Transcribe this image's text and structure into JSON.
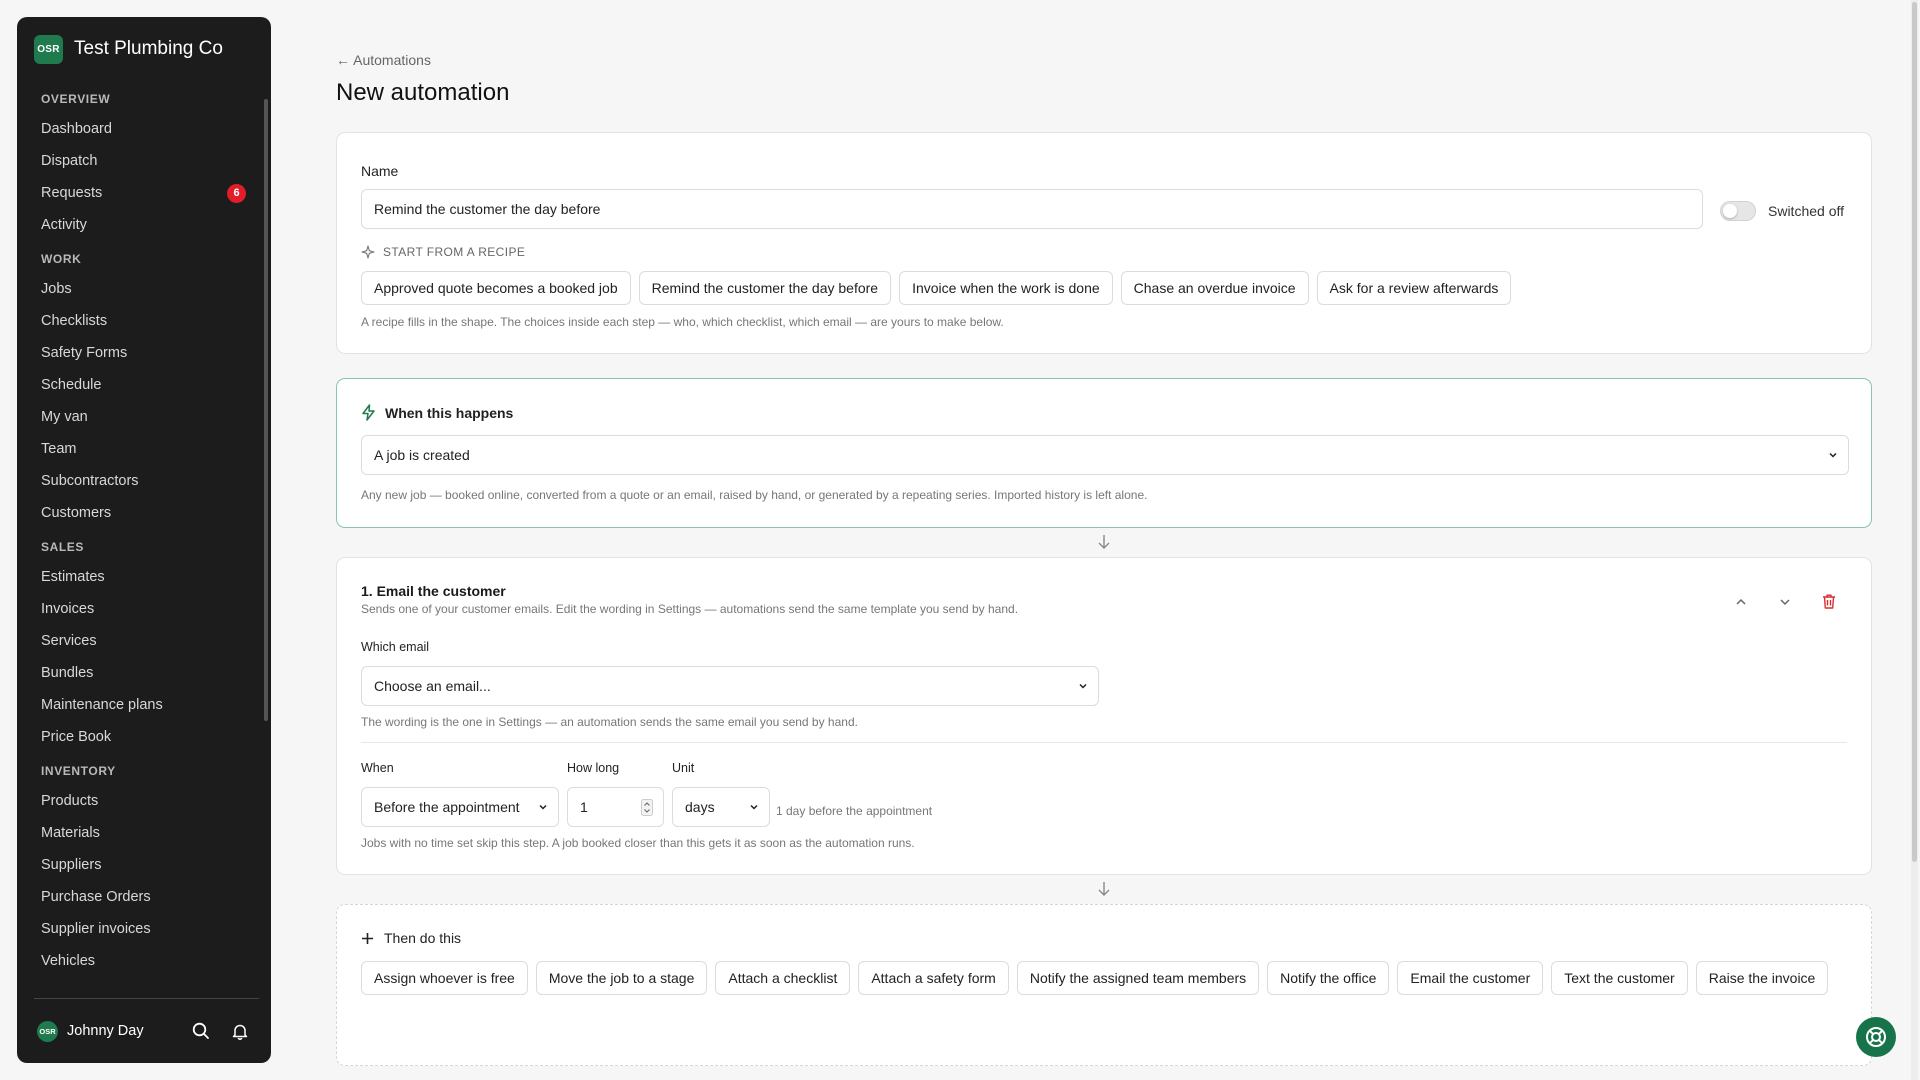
{
  "brand": {
    "badge": "OSR",
    "name": "Test Plumbing Co",
    "color": "#1f7a4d"
  },
  "sidebar": {
    "groups": [
      {
        "label": "OVERVIEW",
        "items": [
          {
            "label": "Dashboard"
          },
          {
            "label": "Dispatch"
          },
          {
            "label": "Requests",
            "badge": "6"
          },
          {
            "label": "Activity"
          }
        ]
      },
      {
        "label": "WORK",
        "items": [
          {
            "label": "Jobs"
          },
          {
            "label": "Checklists"
          },
          {
            "label": "Safety Forms"
          },
          {
            "label": "Schedule"
          },
          {
            "label": "My van"
          },
          {
            "label": "Team"
          },
          {
            "label": "Subcontractors"
          },
          {
            "label": "Customers"
          }
        ]
      },
      {
        "label": "SALES",
        "items": [
          {
            "label": "Estimates"
          },
          {
            "label": "Invoices"
          },
          {
            "label": "Services"
          },
          {
            "label": "Bundles"
          },
          {
            "label": "Maintenance plans"
          },
          {
            "label": "Price Book"
          }
        ]
      },
      {
        "label": "INVENTORY",
        "items": [
          {
            "label": "Products"
          },
          {
            "label": "Materials"
          },
          {
            "label": "Suppliers"
          },
          {
            "label": "Purchase Orders"
          },
          {
            "label": "Supplier invoices"
          },
          {
            "label": "Vehicles"
          }
        ]
      }
    ],
    "user": {
      "badge": "OSR",
      "name": "Johnny Day"
    },
    "icons": [
      "search-icon",
      "bell-icon"
    ]
  },
  "header": {
    "back_label": "Automations",
    "title": "New automation"
  },
  "name_card": {
    "name_label": "Name",
    "name_value": "Remind the customer the day before",
    "toggle_label": "Switched off",
    "recipe_label": "START FROM A RECIPE",
    "recipes": [
      "Approved quote becomes a booked job",
      "Remind the customer the day before",
      "Invoice when the work is done",
      "Chase an overdue invoice",
      "Ask for a review afterwards"
    ],
    "recipe_hint": "A recipe fills in the shape. The choices inside each step — who, which checklist, which email — are yours to make below."
  },
  "trigger_card": {
    "title": "When this happens",
    "selected": "A job is created",
    "hint": "Any new job — booked online, converted from a quote or an email, raised by hand, or generated by a repeating series. Imported history is left alone.",
    "accent": "#1f7a4d"
  },
  "step_card": {
    "title": "1. Email the customer",
    "subtitle": "Sends one of your customer emails. Edit the wording in Settings — automations send the same template you send by hand.",
    "which_email_label": "Which email",
    "which_email_value": "Choose an email...",
    "which_email_hint": "The wording is the one in Settings — an automation sends the same email you send by hand.",
    "when_label": "When",
    "when_value": "Before the appointment",
    "how_long_label": "How long",
    "how_long_value": "1",
    "unit_label": "Unit",
    "unit_value": "days",
    "summary": "1 day before the appointment",
    "timing_hint": "Jobs with no time set skip this step. A job booked closer than this gets it as soon as the automation runs.",
    "delete_color": "#d92d2d"
  },
  "actions_card": {
    "title": "Then do this",
    "actions": [
      "Assign whoever is free",
      "Move the job to a stage",
      "Attach a checklist",
      "Attach a safety form",
      "Notify the assigned team members",
      "Notify the office",
      "Email the customer",
      "Text the customer",
      "Raise the invoice"
    ]
  }
}
